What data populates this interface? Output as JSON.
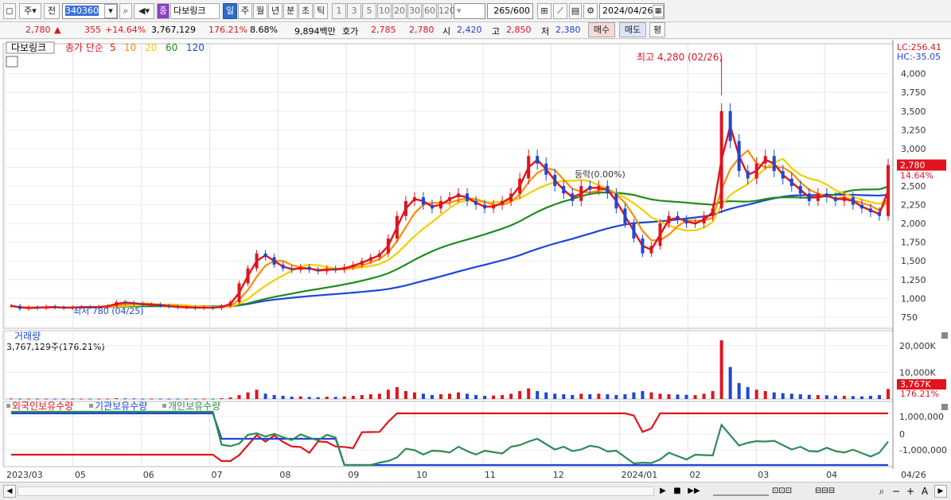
{
  "toolbar": {
    "tab_ju": "주",
    "tab_jeon": "전",
    "code": "340360",
    "stock_badge": "종",
    "stock_name": "다보링크",
    "periods": [
      "일",
      "주",
      "월",
      "년",
      "분",
      "초",
      "틱"
    ],
    "minutes": [
      "1",
      "3",
      "5",
      "10",
      "20",
      "30",
      "60",
      "120"
    ],
    "count": "265",
    "count_total": "/600",
    "date": "2024/04/26"
  },
  "quote": {
    "price": "2,780",
    "arrow": "▲",
    "change": "355",
    "change_pct": "+14.64%",
    "volume": "3,767,129",
    "vol_ratio": "176.21%",
    "turnover": "8.68%",
    "amount": "9,894백만",
    "hoga_label": "호가",
    "ask": "2,785",
    "bid": "2,780",
    "open_label": "시",
    "open": "2,420",
    "high_label": "고",
    "high": "2,850",
    "low_label": "저",
    "low": "2,380",
    "buy": "매수",
    "sell": "매도",
    "eval": "평"
  },
  "chart_data": {
    "type": "line",
    "stock_label": "다보링크",
    "ma_label": "종가 단순",
    "ma_periods": [
      "5",
      "10",
      "20",
      "60",
      "120"
    ],
    "ma_colors": [
      "#e0141e",
      "#ff8c00",
      "#f0d000",
      "#1e8c1e",
      "#1f46d4"
    ],
    "x_labels": [
      "2023/03",
      "05",
      "06",
      "07",
      "08",
      "09",
      "10",
      "11",
      "12",
      "2024/01",
      "02",
      "03",
      "04",
      "04/26"
    ],
    "ylim": [
      600,
      4400
    ],
    "y_ticks": [
      "4,000",
      "3,750",
      "3,500",
      "3,250",
      "3,000",
      "2,750",
      "2,500",
      "2,250",
      "2,000",
      "1,750",
      "1,500",
      "1,250",
      "1,000",
      "750"
    ],
    "lc": "LC:256.41",
    "hc": "HC:-35.05",
    "max_note": "최고 4,280 (02/26)",
    "min_note": "최저 780 (04/25)",
    "midline_note": "등락(0.00%)",
    "last_price": "2,780",
    "last_pct": "14.64%",
    "close": [
      900,
      860,
      880,
      870,
      890,
      880,
      870,
      880,
      885,
      880,
      890,
      900,
      950,
      940,
      930,
      910,
      920,
      900,
      890,
      880,
      880,
      870,
      880,
      870,
      900,
      950,
      1200,
      1400,
      1600,
      1550,
      1450,
      1400,
      1380,
      1420,
      1380,
      1360,
      1400,
      1380,
      1420,
      1450,
      1500,
      1550,
      1600,
      1800,
      2100,
      2300,
      2350,
      2250,
      2200,
      2300,
      2350,
      2400,
      2300,
      2250,
      2200,
      2250,
      2300,
      2400,
      2600,
      2900,
      2800,
      2650,
      2500,
      2400,
      2300,
      2500,
      2450,
      2500,
      2400,
      2200,
      2000,
      1800,
      1600,
      1700,
      2000,
      2100,
      2050,
      2000,
      2000,
      2100,
      2200,
      3500,
      3100,
      2700,
      2600,
      2800,
      2900,
      2700,
      2600,
      2500,
      2400,
      2300,
      2400,
      2350,
      2300,
      2350,
      2250,
      2200,
      2150,
      2100,
      2780
    ],
    "volume_panel": {
      "title": "거래량",
      "summary": "3,767,129주(176.21%)",
      "ticks": [
        "20,000K",
        "10,000K"
      ],
      "last_label": "3,767K",
      "last_pct": "176.21%",
      "values": [
        200,
        150,
        180,
        160,
        150,
        140,
        130,
        160,
        150,
        140,
        150,
        160,
        300,
        250,
        200,
        150,
        170,
        160,
        140,
        130,
        150,
        140,
        160,
        150,
        300,
        600,
        1500,
        2500,
        3500,
        2000,
        1500,
        1200,
        900,
        1000,
        800,
        700,
        900,
        800,
        1000,
        1200,
        1500,
        1800,
        2000,
        3500,
        4500,
        3000,
        2500,
        2000,
        1500,
        1800,
        2000,
        2500,
        2000,
        1500,
        1200,
        1300,
        1500,
        2000,
        3000,
        4000,
        3000,
        2500,
        2000,
        1800,
        1500,
        2000,
        1800,
        2000,
        1800,
        1500,
        1800,
        2500,
        3000,
        2500,
        2000,
        1800,
        1700,
        1600,
        1500,
        2000,
        3000,
        22000,
        12000,
        6000,
        4500,
        3500,
        3000,
        2500,
        2200,
        2000,
        1800,
        1600,
        1500,
        1400,
        1300,
        1200,
        1100,
        1000,
        1200,
        1500,
        3767
      ]
    },
    "holdings_panel": {
      "series": [
        "외국인보유수량",
        "기관보유수량",
        "개인보유수량"
      ],
      "colors": [
        "#e0141e",
        "#1f46d4",
        "#2e8b57"
      ],
      "ticks": [
        "1,000,000",
        "0",
        "-1,000,000"
      ]
    }
  },
  "statusbar": {
    "zoom_minus": "−",
    "zoom_plus": "+",
    "font": "A"
  }
}
